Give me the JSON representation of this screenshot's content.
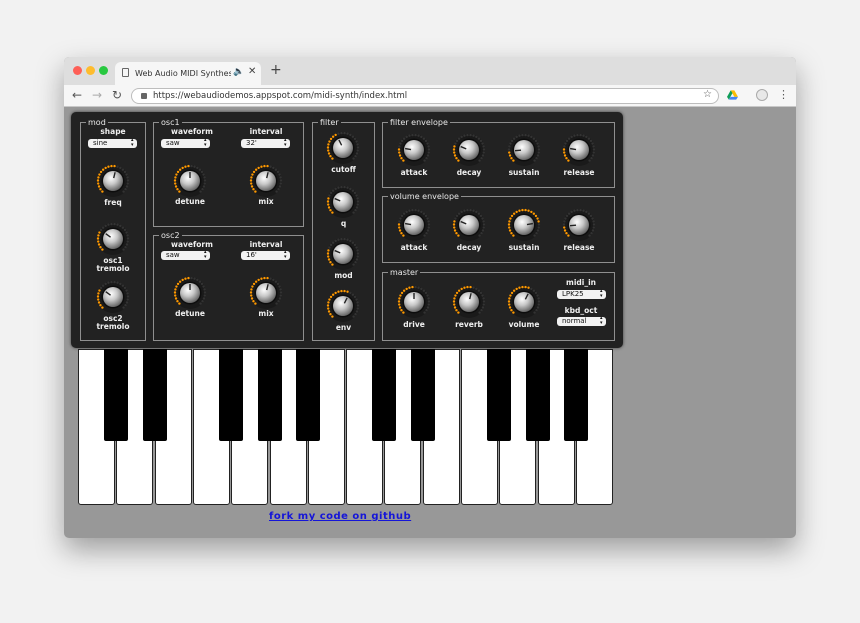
{
  "browser": {
    "tab_title": "Web Audio MIDI Synthesizer",
    "url": "https://webaudiodemos.appspot.com/midi-synth/index.html",
    "traffic_colors": [
      "#fe5f57",
      "#febc2e",
      "#28c840"
    ]
  },
  "synth": {
    "groups": [
      {
        "id": "mod",
        "title": "mod"
      },
      {
        "id": "osc1",
        "title": "osc1"
      },
      {
        "id": "osc2",
        "title": "osc2"
      },
      {
        "id": "filter",
        "title": "filter"
      },
      {
        "id": "filter_env",
        "title": "filter envelope"
      },
      {
        "id": "volume_env",
        "title": "volume envelope"
      },
      {
        "id": "master",
        "title": "master"
      }
    ],
    "labels": {
      "shape": "shape",
      "freq": "freq",
      "osc1_tremolo": "osc1 tremolo",
      "osc2_tremolo": "osc2 tremolo",
      "waveform": "waveform",
      "interval": "interval",
      "detune": "detune",
      "mix": "mix",
      "cutoff": "cutoff",
      "q": "q",
      "mod": "mod",
      "env": "env",
      "attack": "attack",
      "decay": "decay",
      "sustain": "sustain",
      "release": "release",
      "drive": "drive",
      "reverb": "reverb",
      "volume": "volume",
      "midi_in": "midi_in",
      "kbd_oct": "kbd_oct"
    },
    "selects": {
      "mod_shape": "sine",
      "osc1_waveform": "saw",
      "osc1_interval": "32'",
      "osc2_waveform": "saw",
      "osc2_interval": "16'",
      "midi_in": "LPK25",
      "kbd_oct": "normal"
    },
    "knobs": {
      "freq": 0.55,
      "osc1_tremolo": 0.3,
      "osc2_tremolo": 0.3,
      "osc1_detune": 0.5,
      "osc1_mix": 0.55,
      "osc2_detune": 0.5,
      "osc2_mix": 0.55,
      "cutoff": 0.4,
      "q": 0.25,
      "mod": 0.25,
      "env": 0.6,
      "fenv_attack": 0.2,
      "fenv_decay": 0.25,
      "fenv_sustain": 0.15,
      "fenv_release": 0.2,
      "venv_attack": 0.2,
      "venv_decay": 0.25,
      "venv_sustain": 0.8,
      "venv_release": 0.15,
      "drive": 0.5,
      "reverb": 0.55,
      "volume": 0.6
    },
    "accent_color": "#ff9900"
  },
  "footer": {
    "github_link": "fork my code on github"
  }
}
